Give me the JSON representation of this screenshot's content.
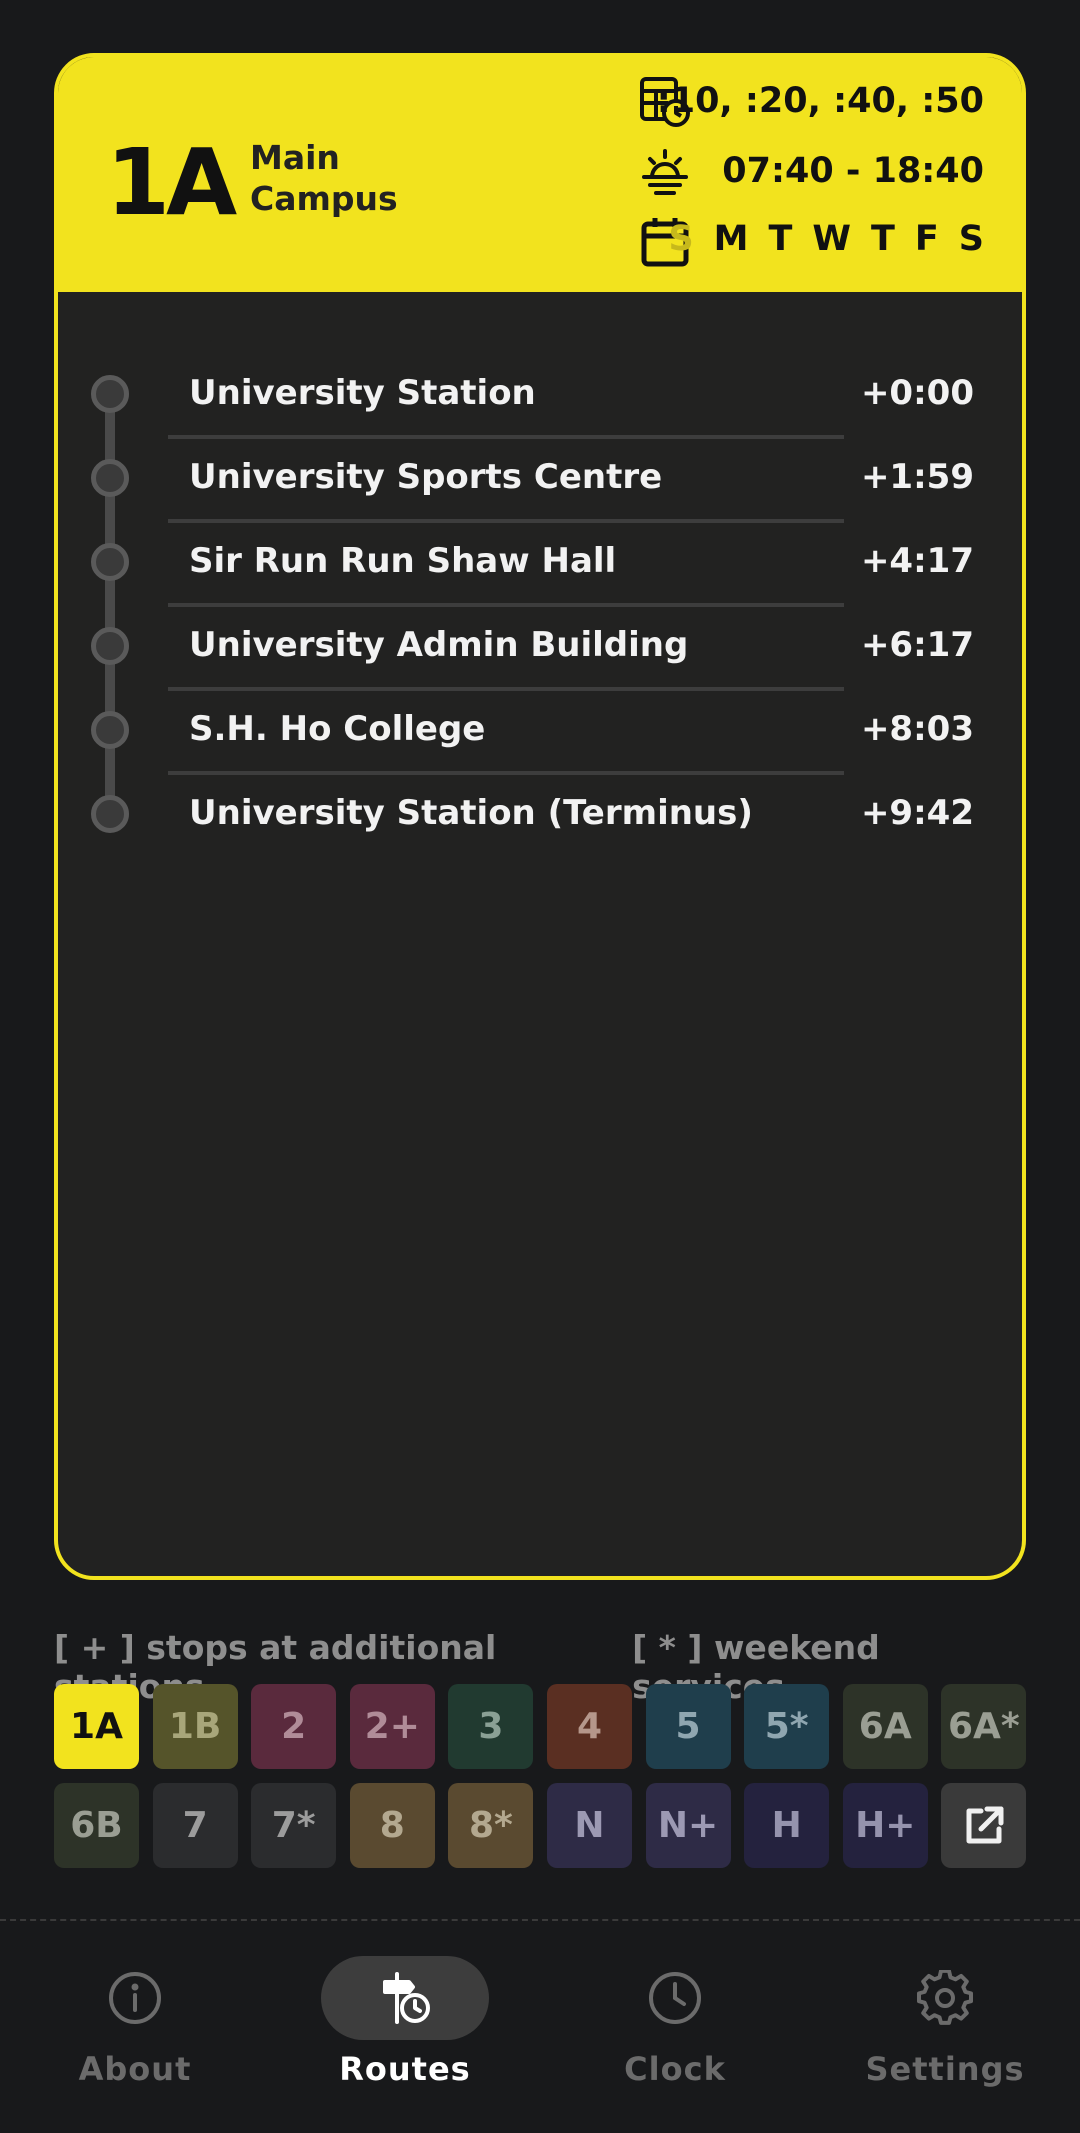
{
  "route": {
    "code": "1A",
    "name": "Main Campus",
    "frequency": ":10, :20, :40, :50",
    "hours": "07:40 - 18:40",
    "days": [
      {
        "label": "S",
        "active": false
      },
      {
        "label": "M",
        "active": true
      },
      {
        "label": "T",
        "active": true
      },
      {
        "label": "W",
        "active": true
      },
      {
        "label": "T",
        "active": true
      },
      {
        "label": "F",
        "active": true
      },
      {
        "label": "S",
        "active": true
      }
    ],
    "accent_color": "#f2e31e"
  },
  "stops": [
    {
      "name": "University Station",
      "time": "+0:00"
    },
    {
      "name": "University Sports Centre",
      "time": "+1:59"
    },
    {
      "name": "Sir Run Run Shaw Hall",
      "time": "+4:17"
    },
    {
      "name": "University Admin Building",
      "time": "+6:17"
    },
    {
      "name": "S.H. Ho College",
      "time": "+8:03"
    },
    {
      "name": "University Station (Terminus)",
      "time": "+9:42"
    }
  ],
  "legend": {
    "additional": "[ + ] stops at additional stations",
    "weekend": "[ * ] weekend services"
  },
  "routes": [
    {
      "label": "1A",
      "bg": "#f2e31e",
      "fg": "#111111",
      "selected": true
    },
    {
      "label": "1B",
      "bg": "#55542a",
      "fg": "#a8a67a",
      "selected": false
    },
    {
      "label": "2",
      "bg": "#5a2a3d",
      "fg": "#b08c98",
      "selected": false
    },
    {
      "label": "2+",
      "bg": "#5a2a3d",
      "fg": "#b08c98",
      "selected": false
    },
    {
      "label": "3",
      "bg": "#213a30",
      "fg": "#8aa095",
      "selected": false
    },
    {
      "label": "4",
      "bg": "#5a2f22",
      "fg": "#b5978b",
      "selected": false
    },
    {
      "label": "5",
      "bg": "#1f3e4c",
      "fg": "#8fa6b0",
      "selected": false
    },
    {
      "label": "5*",
      "bg": "#1f3e4c",
      "fg": "#8fa6b0",
      "selected": false
    },
    {
      "label": "6A",
      "bg": "#2d3328",
      "fg": "#9a9e93",
      "selected": false
    },
    {
      "label": "6A*",
      "bg": "#2d3328",
      "fg": "#9a9e93",
      "selected": false
    },
    {
      "label": "6B",
      "bg": "#2d3328",
      "fg": "#9a9e93",
      "selected": false
    },
    {
      "label": "7",
      "bg": "#2b2c2e",
      "fg": "#9c9c9c",
      "selected": false
    },
    {
      "label": "7*",
      "bg": "#2b2c2e",
      "fg": "#9c9c9c",
      "selected": false
    },
    {
      "label": "8",
      "bg": "#5a4a30",
      "fg": "#b3a88f",
      "selected": false
    },
    {
      "label": "8*",
      "bg": "#5a4a30",
      "fg": "#b3a88f",
      "selected": false
    },
    {
      "label": "N",
      "bg": "#2e2b46",
      "fg": "#9c99b3",
      "selected": false
    },
    {
      "label": "N+",
      "bg": "#2e2b46",
      "fg": "#9c99b3",
      "selected": false
    },
    {
      "label": "H",
      "bg": "#24223e",
      "fg": "#9593ad",
      "selected": false
    },
    {
      "label": "H+",
      "bg": "#24223e",
      "fg": "#9593ad",
      "selected": false
    }
  ],
  "external_link_icon": "external-link-icon",
  "nav": [
    {
      "label": "About",
      "icon": "info-icon",
      "active": false
    },
    {
      "label": "Routes",
      "icon": "route-clock-icon",
      "active": true
    },
    {
      "label": "Clock",
      "icon": "clock-icon",
      "active": false
    },
    {
      "label": "Settings",
      "icon": "gear-icon",
      "active": false
    }
  ]
}
